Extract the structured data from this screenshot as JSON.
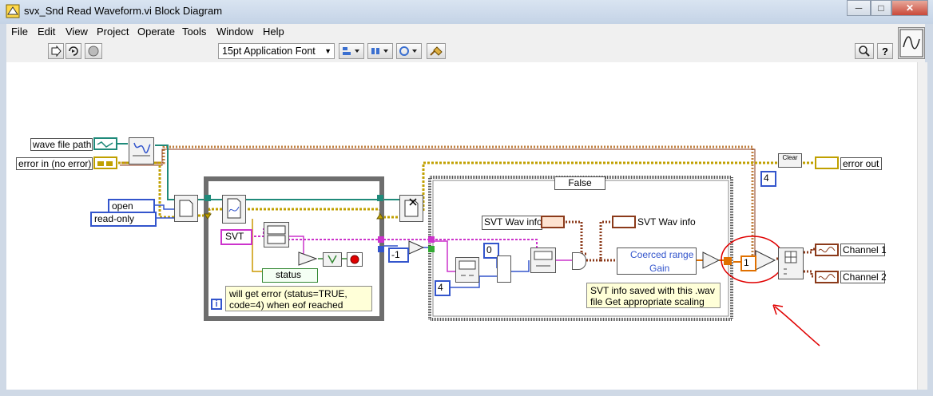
{
  "window": {
    "title": "svx_Snd Read Waveform.vi Block Diagram",
    "controls": {
      "minimize": "─",
      "maximize": "□",
      "close": "✕"
    }
  },
  "menu": [
    "File",
    "Edit",
    "View",
    "Project",
    "Operate",
    "Tools",
    "Window",
    "Help"
  ],
  "toolbar": {
    "font": "15pt Application Font",
    "font_arrow": "▼",
    "run_icon": "run-icon",
    "help_label": "?"
  },
  "diagram": {
    "inputs": {
      "wave_file_path": "wave file path",
      "error_in": "error in (no error)"
    },
    "constants": {
      "open": "open",
      "read_only": "read-only",
      "svt": "SVT",
      "minus_one": "-1",
      "four_a": "4",
      "four_b": "4",
      "zero": "0",
      "one": "1"
    },
    "case_selector": "False",
    "labels": {
      "status": "status",
      "svt_wav_info_1": "SVT Wav info",
      "svt_wav_info_2": "SVT Wav info",
      "coerced_range": "Coerced range",
      "gain": "Gain",
      "error_out": "error out",
      "channel_1": "Channel 1",
      "channel_2": "Channel 2",
      "loop_index": "i",
      "clear": "Clear"
    },
    "notes": {
      "eof_note": "will get error (status=TRUE, code=4) when eof reached",
      "scaling_note": "SVT info saved with this .wav file Get appropriate scaling"
    },
    "wire_colors": {
      "error": "#c08040",
      "error_dark": "#8b3a1a",
      "refnum": "#1f8a7a",
      "cluster": "#cc33cc",
      "numeric": "#3355cc",
      "array": "#c0a000",
      "bool": "#338833",
      "annotation": "#e00000"
    }
  }
}
